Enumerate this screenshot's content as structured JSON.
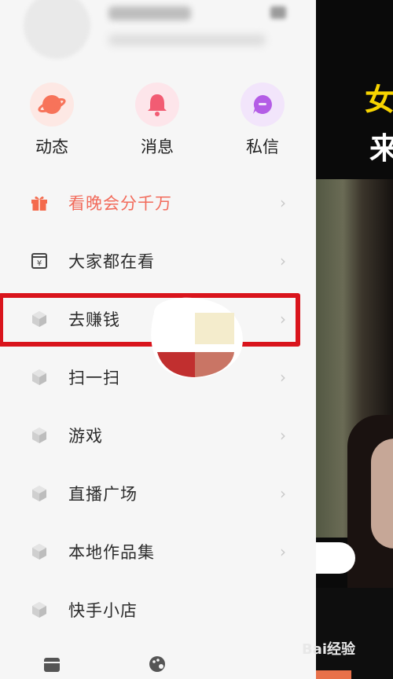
{
  "quick_actions": [
    {
      "label": "动态",
      "icon": "planet-icon",
      "color": "#f7735a",
      "bg": "#fde8e4"
    },
    {
      "label": "消息",
      "icon": "bell-icon",
      "color": "#f25c73",
      "bg": "#fde5ea"
    },
    {
      "label": "私信",
      "icon": "chat-icon",
      "color": "#b45de6",
      "bg": "#f2e5fb"
    }
  ],
  "menu": [
    {
      "label": "看晚会分千万",
      "icon": "gift-icon"
    },
    {
      "label": "大家都在看",
      "icon": "calendar-yen-icon"
    },
    {
      "label": "去赚钱",
      "icon": "cube-icon"
    },
    {
      "label": "扫一扫",
      "icon": "cube-icon"
    },
    {
      "label": "游戏",
      "icon": "cube-icon"
    },
    {
      "label": "直播广场",
      "icon": "cube-icon"
    },
    {
      "label": "本地作品集",
      "icon": "cube-icon"
    },
    {
      "label": "快手小店",
      "icon": "cube-icon"
    }
  ],
  "right_panel": {
    "text_line1": "女",
    "text_line2": "来"
  },
  "watermark": "Bai经验",
  "colors": {
    "highlight_box": "#d9141c",
    "accent_text": "#f26b5b"
  }
}
